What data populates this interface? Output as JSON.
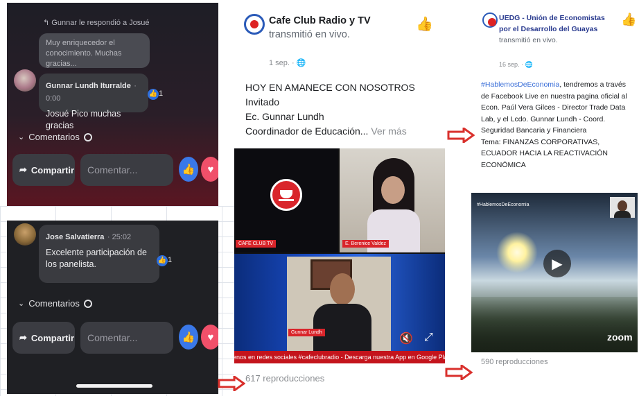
{
  "left_top": {
    "reply_notice": "Gunnar le respondió a Josué",
    "previous_comment": "Muy enriquecedor el conocimiento. Muchas gracias...",
    "comment": {
      "author": "Gunnar Lundh Iturralde",
      "time": "0:00",
      "text": "Josué Pico muchas gracias",
      "likes": "1"
    },
    "comments_label": "Comentarios",
    "share_label": "Compartir",
    "comment_placeholder": "Comentar..."
  },
  "left_bottom": {
    "comment": {
      "author": "Jose Salvatierra",
      "time": "25:02",
      "text": "Excelente participación de los panelista.",
      "likes": "1"
    },
    "comments_label": "Comentarios",
    "share_label": "Compartir",
    "comment_placeholder": "Comentar..."
  },
  "middle_post": {
    "page_name": "Cafe Club Radio y TV",
    "action": "transmitió en vivo.",
    "date": "1 sep.",
    "body_line1": "HOY EN AMANECE CON NOSOTROS Invitado",
    "body_line2": "Ec. Gunnar Lundh",
    "body_line3": "Coordinador de Educación...",
    "see_more": "Ver más",
    "video": {
      "label_cafe": "CAFE CLUB TV",
      "label_guest": "E. Berenice Valdez",
      "label_host": "Gunnar Lundh",
      "ticker": "enos en redes sociales #cafeclubradio - Descarga nuestra App en Google Play y disfruta de"
    },
    "views": "617 reproducciones"
  },
  "right_post": {
    "page_name": "UEDG - Unión de Economistas por el Desarrollo del Guayas",
    "action": "transmitió en vivo.",
    "date": "16 sep.",
    "hashtag": "#HablemosDeEconomia",
    "body": ", tendremos a través de Facebook Live en nuestra pagina oficial al Econ. Paúl Vera Gilces - Director Trade Data Lab, y el Lcdo. Gunnar Lundh - Coord. Seguridad Bancaria y Financiera",
    "tema": "Tema: FINANZAS CORPORATIVAS, ECUADOR HACIA LA REACTIVACIÓN ECONÓMICA",
    "video_hashtag": "#HablemosDeEconomia",
    "zoom_logo": "zoom",
    "views": "590 reproducciones"
  },
  "colors": {
    "arrow": "#d9302c",
    "facebook_blue": "#1877f2"
  }
}
